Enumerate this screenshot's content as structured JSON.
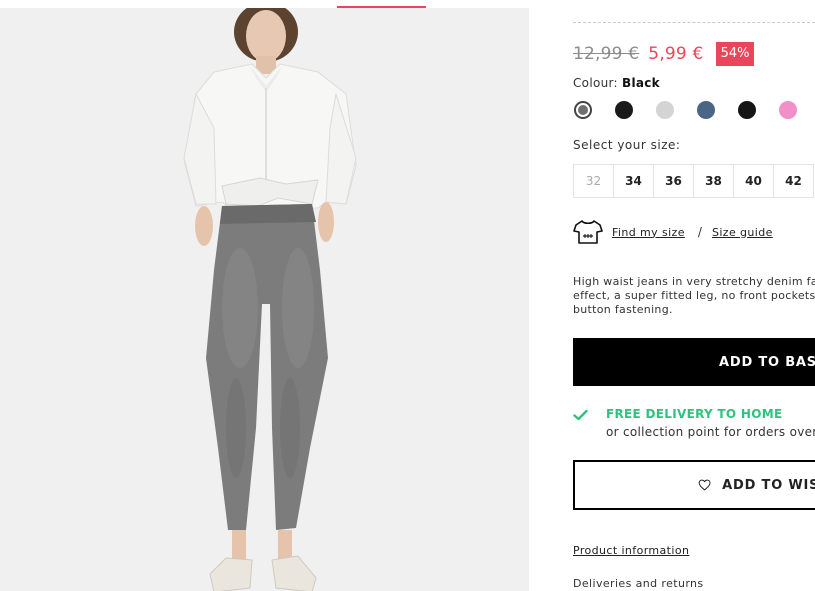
{
  "product": {
    "old_price": "12,99 €",
    "new_price": "5,99 €",
    "discount": "54%",
    "colour_label": "Colour:",
    "colour_value": "Black",
    "swatches": [
      {
        "name": "grey-acid-wash",
        "color": "#6f6f6f",
        "selected": true
      },
      {
        "name": "black",
        "color": "#1a1a1a"
      },
      {
        "name": "light-grey",
        "color": "#d4d4d4"
      },
      {
        "name": "blue-denim",
        "color": "#4a6585"
      },
      {
        "name": "black-2",
        "color": "#151515"
      },
      {
        "name": "pink",
        "color": "#f08fc8"
      }
    ],
    "size_label": "Select your size:",
    "sizes": [
      "32",
      "34",
      "36",
      "38",
      "40",
      "42"
    ],
    "find_size": "Find my size",
    "separator": "/",
    "size_guide": "Size guide",
    "description_lines": [
      "High waist jeans in very stretchy denim fab",
      "effect, a super fitted leg, no front pockets",
      "button fastening."
    ],
    "add_to_basket": "ADD TO BASK",
    "free_delivery": "FREE DELIVERY TO HOME",
    "collection_point": "or collection point for orders over",
    "add_to_wishlist": "ADD TO WISH",
    "product_information": "Product information",
    "deliveries_returns": "Deliveries and returns"
  },
  "colors": {
    "accent": "#e9465b",
    "delivery_green": "#2ec27e",
    "button_black": "#000000",
    "photo_bg": "#f0f0f0"
  },
  "icons": [
    "t-shirt-icon",
    "check-icon",
    "heart-icon"
  ]
}
